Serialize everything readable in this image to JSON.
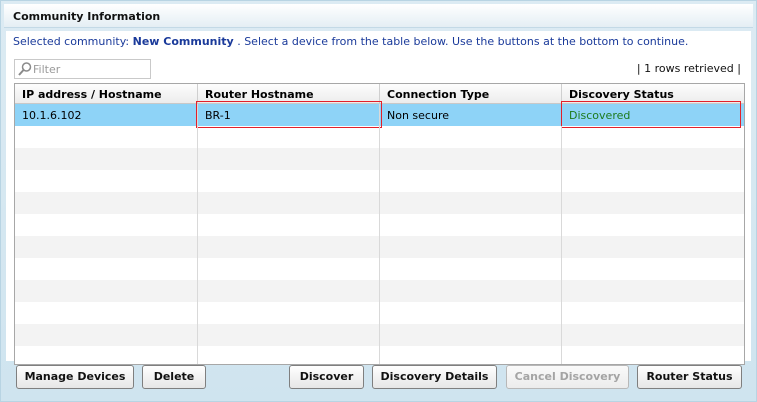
{
  "window": {
    "title": "Community Information"
  },
  "info": {
    "prefix": "Selected community:",
    "community": "New Community",
    "suffix": ".  Select a device from the table below. Use the buttons at the bottom to continue."
  },
  "filter": {
    "placeholder": "Filter",
    "icon": "search-icon"
  },
  "rows_retrieved": "| 1 rows retrieved |",
  "table": {
    "columns": [
      "IP address / Hostname",
      "Router Hostname",
      "Connection Type",
      "Discovery Status"
    ],
    "rows": [
      {
        "ip": "10.1.6.102",
        "router": "BR-1",
        "connection": "Non secure",
        "status": "Discovered"
      }
    ]
  },
  "colors": {
    "selected_row": "#8ed3f7",
    "highlight_border": "#e2202a",
    "status_discovered": "#1d7a1d",
    "info_text": "#1a3a9a"
  },
  "buttons": {
    "manage_devices": "Manage Devices",
    "delete": "Delete",
    "discover": "Discover",
    "discovery_details": "Discovery Details",
    "cancel_discovery": "Cancel Discovery",
    "router_status": "Router Status"
  }
}
